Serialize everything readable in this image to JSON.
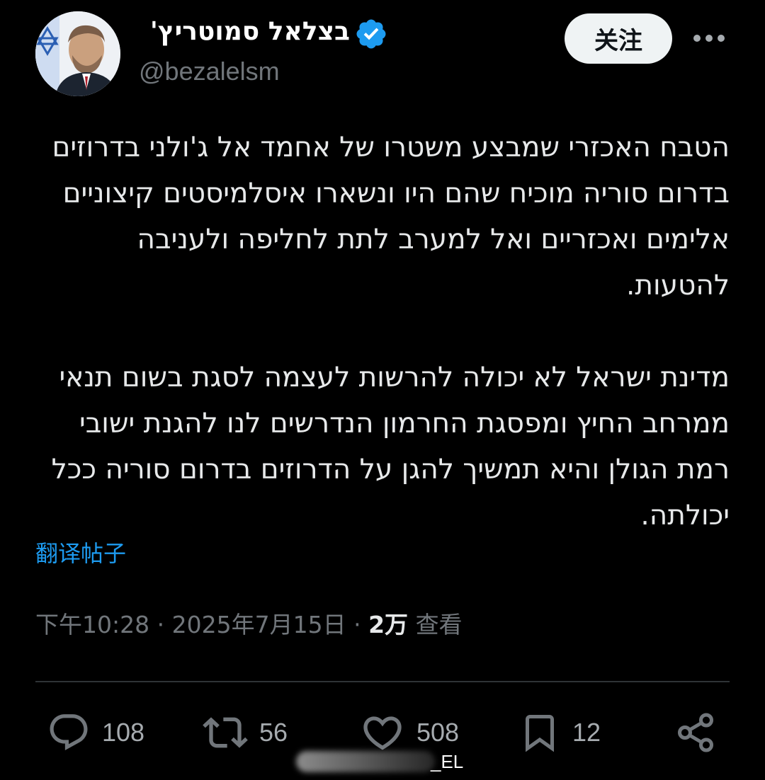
{
  "author": {
    "name": "בצלאל סמוטריץ'",
    "handle": "@bezalelsm",
    "verified": true
  },
  "header": {
    "follow_label": "关注",
    "more_icon": "more-horizontal-icon"
  },
  "post": {
    "paragraphs": [
      "הטבח האכזרי שמבצע משטרו של אחמד אל ג'ולני בדרוזים בדרום סוריה מוכיח שהם היו ונשארו איסלמיסטים קיצוניים אלימים ואכזריים ואל למערב לתת לחליפה ולעניבה להטעות.",
      "מדינת ישראל לא יכולה להרשות לעצמה לסגת בשום תנאי ממרחב החיץ ומפסגת החרמון הנדרשים לנו להגנת ישובי רמת הגולן והיא תמשיך להגן על הדרוזים בדרום סוריה ככל יכולתה."
    ],
    "translate_label": "翻译帖子",
    "time": "下午10:28",
    "separator": "·",
    "date": "2025年7月15日",
    "views_count": "2万",
    "views_label": "查看"
  },
  "actions": {
    "replies": "108",
    "reposts": "56",
    "likes": "508",
    "bookmarks": "12"
  },
  "watermark": {
    "text": "_EL"
  },
  "colors": {
    "background": "#000000",
    "text": "#e7e9ea",
    "muted": "#71767b",
    "link": "#1d9bf0",
    "verified": "#1d9bf0",
    "follow_bg": "#eff3f4"
  }
}
